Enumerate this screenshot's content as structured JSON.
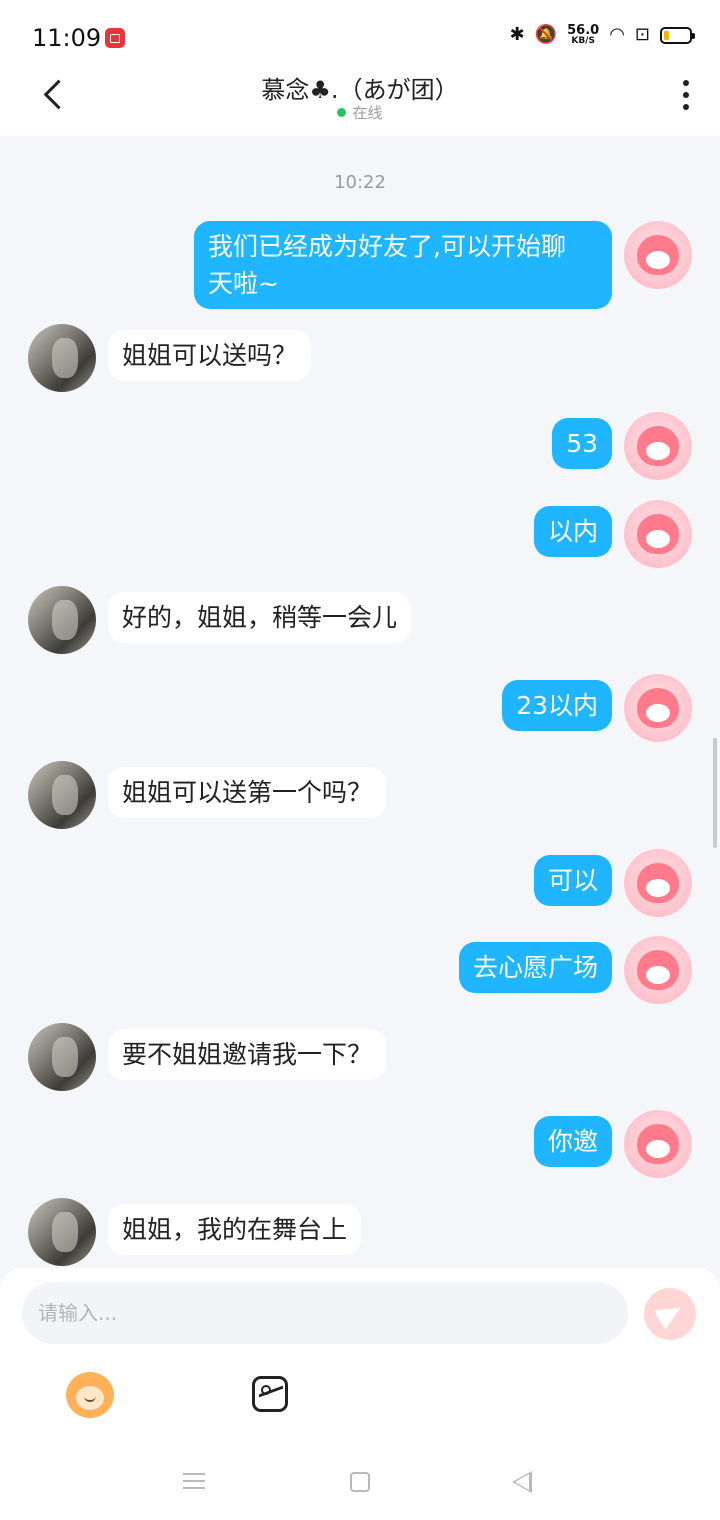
{
  "status_bar": {
    "time": "11:09",
    "speed_value": "56.0",
    "speed_unit": "KB/S"
  },
  "header": {
    "title": "慕念♣.（あが团）",
    "status": "在线"
  },
  "chat": {
    "timestamp": "10:22",
    "messages": [
      {
        "side": "out",
        "text1": "我们已经成为好友了,可以开始聊",
        "text2": "天啦~"
      },
      {
        "side": "in",
        "text1": "姐姐可以送吗？"
      },
      {
        "side": "out",
        "text1": "53"
      },
      {
        "side": "out",
        "text1": "以内"
      },
      {
        "side": "in",
        "text1": "好的，姐姐，稍等一会儿"
      },
      {
        "side": "out",
        "text1": "23以内"
      },
      {
        "side": "in",
        "text1": " 姐姐可以送第一个吗？"
      },
      {
        "side": "out",
        "text1": "可以"
      },
      {
        "side": "out",
        "text1": "去心愿广场"
      },
      {
        "side": "in",
        "text1": "要不姐姐邀请我一下？"
      },
      {
        "side": "out",
        "text1": "你邀"
      },
      {
        "side": "in",
        "text1": "姐姐，我的在舞台上"
      }
    ]
  },
  "composer": {
    "placeholder": "请输入..."
  },
  "colors": {
    "outgoing_bubble": "#1fb6ff",
    "incoming_bubble": "#ffffff",
    "online_dot": "#22c55e"
  }
}
